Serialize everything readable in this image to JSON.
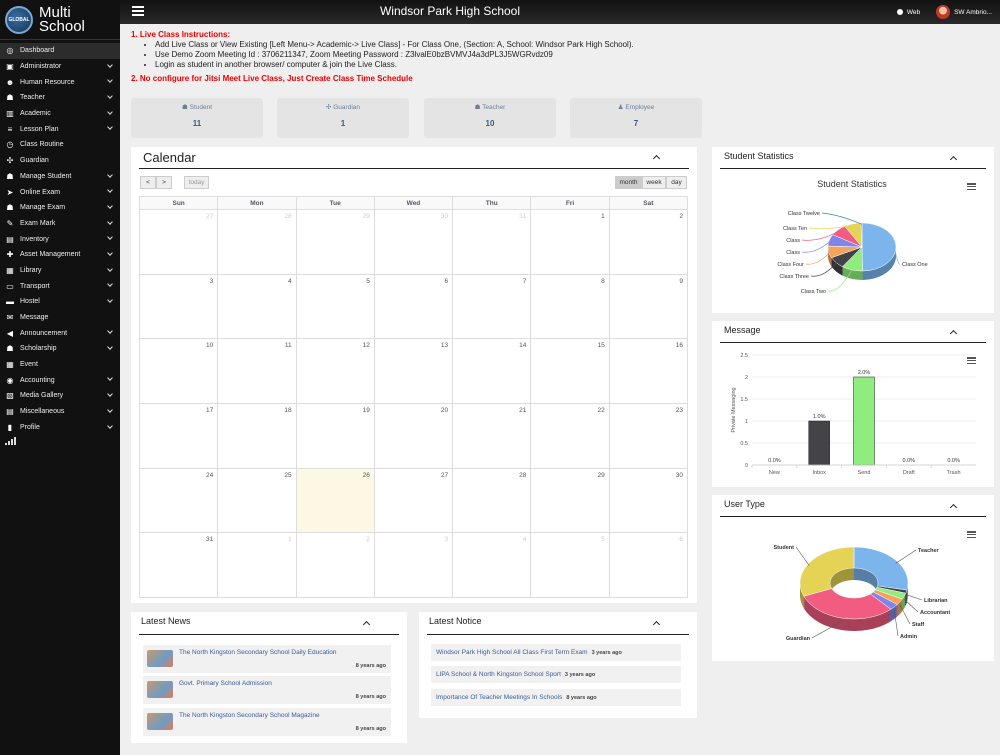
{
  "app": {
    "logo_text_1": "Multi",
    "logo_text_2": "School",
    "logo_globe": "GLOBAL",
    "school_name": "Windsor Park High School",
    "web_label": "Web",
    "user_name": "SW Ambrio..."
  },
  "sidebar": {
    "items": [
      {
        "label": "Dashboard",
        "icon": "dashboard-icon",
        "glyph": "◎",
        "chevron": false
      },
      {
        "label": "Administrator",
        "icon": "admin-icon",
        "glyph": "▣",
        "chevron": true
      },
      {
        "label": "Human Resource",
        "icon": "hr-icon",
        "glyph": "☻",
        "chevron": true
      },
      {
        "label": "Teacher",
        "icon": "teacher-icon",
        "glyph": "☗",
        "chevron": true
      },
      {
        "label": "Academic",
        "icon": "academic-icon",
        "glyph": "▥",
        "chevron": true
      },
      {
        "label": "Lesson Plan",
        "icon": "lesson-plan-icon",
        "glyph": "≡",
        "chevron": true
      },
      {
        "label": "Class Routine",
        "icon": "clock-icon",
        "glyph": "◷",
        "chevron": false
      },
      {
        "label": "Guardian",
        "icon": "guardian-icon",
        "glyph": "✣",
        "chevron": false
      },
      {
        "label": "Manage Student",
        "icon": "student-icon",
        "glyph": "☗",
        "chevron": true
      },
      {
        "label": "Online Exam",
        "icon": "pointer-icon",
        "glyph": "➤",
        "chevron": true
      },
      {
        "label": "Manage Exam",
        "icon": "graduation-icon",
        "glyph": "☗",
        "chevron": true
      },
      {
        "label": "Exam Mark",
        "icon": "mark-icon",
        "glyph": "✎",
        "chevron": true
      },
      {
        "label": "Inventory",
        "icon": "inventory-icon",
        "glyph": "▤",
        "chevron": true
      },
      {
        "label": "Asset Management",
        "icon": "asset-icon",
        "glyph": "✚",
        "chevron": true
      },
      {
        "label": "Library",
        "icon": "library-icon",
        "glyph": "▦",
        "chevron": true
      },
      {
        "label": "Transport",
        "icon": "bus-icon",
        "glyph": "▭",
        "chevron": true
      },
      {
        "label": "Hostel",
        "icon": "hostel-icon",
        "glyph": "▬",
        "chevron": true
      },
      {
        "label": "Message",
        "icon": "message-icon",
        "glyph": "✉",
        "chevron": false
      },
      {
        "label": "Announcement",
        "icon": "announcement-icon",
        "glyph": "◀",
        "chevron": true
      },
      {
        "label": "Scholarship",
        "icon": "scholarship-icon",
        "glyph": "☗",
        "chevron": true
      },
      {
        "label": "Event",
        "icon": "event-icon",
        "glyph": "▦",
        "chevron": false
      },
      {
        "label": "Accounting",
        "icon": "accounting-icon",
        "glyph": "◉",
        "chevron": true
      },
      {
        "label": "Media Gallery",
        "icon": "gallery-icon",
        "glyph": "▧",
        "chevron": true
      },
      {
        "label": "Miscellaneous",
        "icon": "misc-icon",
        "glyph": "▤",
        "chevron": true
      },
      {
        "label": "Profile",
        "icon": "lock-icon",
        "glyph": "▮",
        "chevron": true
      }
    ]
  },
  "instructions": {
    "heading_1": "1. Live Class Instructions:",
    "bullets": [
      "Add Live Class or View Existing [Left Menu-> Academic-> Live Class] - For Class One, (Section: A, School: Windsor Park High School).",
      "Use Demo Zoom Meeting Id : 3706211347, Zoom Meeting Password : Z3lvalE0bzBVMVJ4a3dPL3J5WGRvdz09",
      "Login as student in another browser/ computer & join the Live Class."
    ],
    "heading_2": "2. No configure for Jitsi Meet Live Class, Just Create Class Time Schedule"
  },
  "stats": [
    {
      "label": "Student",
      "value": "11"
    },
    {
      "label": "Guardian",
      "value": "1"
    },
    {
      "label": "Teacher",
      "value": "10"
    },
    {
      "label": "Employee",
      "value": "7"
    }
  ],
  "calendar": {
    "title": "Calendar",
    "prev_label": "<",
    "next_label": ">",
    "today_label": "today",
    "views": [
      "month",
      "week",
      "day"
    ],
    "weekdays": [
      "Sun",
      "Mon",
      "Tue",
      "Wed",
      "Thu",
      "Fri",
      "Sat"
    ],
    "weeks": [
      [
        "27",
        "28",
        "29",
        "30",
        "31",
        "1",
        "2"
      ],
      [
        "3",
        "4",
        "5",
        "6",
        "7",
        "8",
        "9"
      ],
      [
        "10",
        "11",
        "12",
        "13",
        "14",
        "15",
        "16"
      ],
      [
        "17",
        "18",
        "19",
        "20",
        "21",
        "22",
        "23"
      ],
      [
        "24",
        "25",
        "26",
        "27",
        "28",
        "29",
        "30"
      ],
      [
        "31",
        "1",
        "2",
        "3",
        "4",
        "5",
        "6"
      ]
    ],
    "today": "26"
  },
  "news": {
    "title": "Latest News",
    "items": [
      {
        "title": "The North Kingston Secondary School Daily Education",
        "time": "8 years ago"
      },
      {
        "title": "Govt. Primary School Admission",
        "time": "8 years ago"
      },
      {
        "title": "The North Kingston Secondary School Magazine",
        "time": "8 years ago"
      }
    ]
  },
  "notice": {
    "title": "Latest Notice",
    "items": [
      {
        "title": "Windsor Park High School All Class First Term Exam",
        "time": "3 years ago"
      },
      {
        "title": "LIPA School & North Kingston School Sport",
        "time": "3 years ago"
      },
      {
        "title": "Importance Of Teacher Meetings In Schools",
        "time": "8 years ago"
      }
    ]
  },
  "student_stats": {
    "panel_title": "Student Statistics",
    "chart_title": "Student Statistics",
    "chart_data": {
      "type": "pie",
      "title": "Student Statistics",
      "slices": [
        {
          "label": "Class One",
          "value": 50,
          "color": "#7cb5ec"
        },
        {
          "label": "Class Two",
          "value": 10,
          "color": "#90ed7d"
        },
        {
          "label": "Class Three",
          "value": 8,
          "color": "#434348"
        },
        {
          "label": "Class Four",
          "value": 8,
          "color": "#f7a35c"
        },
        {
          "label": "Class",
          "value": 8,
          "color": "#8085e9"
        },
        {
          "label": "Class",
          "value": 8,
          "color": "#f15c80"
        },
        {
          "label": "Class Ten",
          "value": 8,
          "color": "#e4d354"
        },
        {
          "label": "Class Twelve",
          "value": 0.5,
          "color": "#2b908f"
        }
      ]
    }
  },
  "message": {
    "panel_title": "Message",
    "chart_data": {
      "type": "bar",
      "categories": [
        "New",
        "Inbox",
        "Send",
        "Draft",
        "Trash"
      ],
      "values": [
        0,
        1,
        2,
        0,
        0
      ],
      "data_labels": [
        "0.0%",
        "1.0%",
        "2.0%",
        "0.0%",
        "0.0%"
      ],
      "colors": [
        "#7cb5ec",
        "#434348",
        "#90ed7d",
        "#f7a35c",
        "#8085e9"
      ],
      "ylabel": "Private Messaging",
      "ylim": [
        0,
        2.5
      ],
      "yticks": [
        "0",
        "0.5",
        "1",
        "1.5",
        "2",
        "2.5"
      ]
    }
  },
  "user_type": {
    "panel_title": "User Type",
    "chart_data": {
      "type": "pie",
      "slices": [
        {
          "label": "Teacher",
          "value": 10,
          "color": "#7cb5ec"
        },
        {
          "label": "Librarian",
          "value": 0.5,
          "color": "#434348"
        },
        {
          "label": "Accountant",
          "value": 1,
          "color": "#90ed7d"
        },
        {
          "label": "Staff",
          "value": 1,
          "color": "#f7a35c"
        },
        {
          "label": "Admin",
          "value": 1,
          "color": "#8085e9"
        },
        {
          "label": "Guardian",
          "value": 11,
          "color": "#f15c80"
        },
        {
          "label": "Student",
          "value": 11,
          "color": "#e4d354"
        }
      ]
    }
  }
}
